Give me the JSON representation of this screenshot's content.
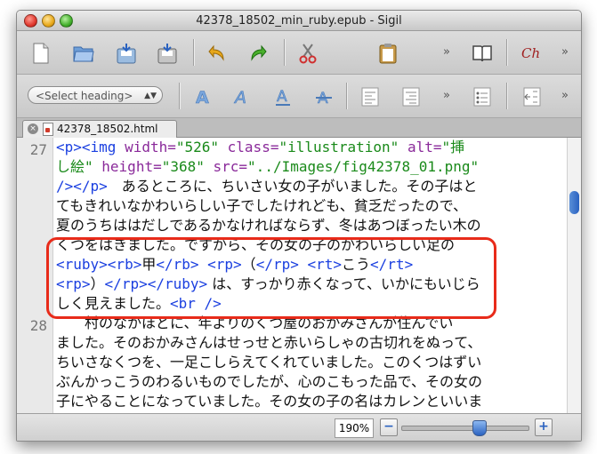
{
  "window": {
    "title": "42378_18502_min_ruby.epub - Sigil"
  },
  "toolbar1": {
    "icons": [
      "new-file-icon",
      "open-folder-icon",
      "save-icon",
      "save-as-icon",
      "undo-icon",
      "redo-icon",
      "cut-icon",
      "paste-icon",
      "book-view-icon",
      "spellcheck-icon"
    ],
    "overflow_label": "»"
  },
  "toolbar2": {
    "heading_select": "<Select heading>",
    "icons": [
      "bold-icon",
      "italic-icon",
      "underline-icon",
      "strikethrough-icon",
      "align-left-icon",
      "align-right-icon",
      "bullet-list-icon",
      "indent-icon"
    ],
    "overflow_label": "»"
  },
  "tab": {
    "close_label": "×",
    "filename": "42378_18502.html"
  },
  "editor": {
    "line_numbers": [
      "27",
      "28"
    ],
    "lines": [
      [
        {
          "c": "tag",
          "t": "    <p><img "
        },
        {
          "c": "attr",
          "t": "width="
        },
        {
          "c": "val",
          "t": "\"526\" "
        },
        {
          "c": "attr",
          "t": "class="
        },
        {
          "c": "val",
          "t": "\"illustration\" "
        },
        {
          "c": "attr",
          "t": "alt="
        },
        {
          "c": "val",
          "t": "\"挿"
        }
      ],
      [
        {
          "c": "val",
          "t": "し絵\" "
        },
        {
          "c": "attr",
          "t": "height="
        },
        {
          "c": "val",
          "t": "\"368\" "
        },
        {
          "c": "attr",
          "t": "src="
        },
        {
          "c": "val",
          "t": "\"../Images/fig42378_01.png\""
        }
      ],
      [
        {
          "c": "tag",
          "t": " /></p>"
        },
        {
          "c": "txt",
          "t": "　あるところに、ちいさい女の子がいました。その子はと"
        }
      ],
      [
        {
          "c": "txt",
          "t": "てもきれいなかわいらしい子でしたけれども、貧乏だったので、"
        }
      ],
      [
        {
          "c": "txt",
          "t": "夏のうちははだしであるかなければならず、冬はあつぼったい木の"
        }
      ],
      [
        {
          "c": "txt",
          "t": "くつをはきました。ですから、その女の子のかわいらしい足の"
        }
      ],
      [
        {
          "c": "tag",
          "t": "<ruby><rb>"
        },
        {
          "c": "txt",
          "t": "甲"
        },
        {
          "c": "tag",
          "t": "</rb> <rp>"
        },
        {
          "c": "txt",
          "t": "（"
        },
        {
          "c": "tag",
          "t": "</rp> <rt>"
        },
        {
          "c": "txt",
          "t": "こう"
        },
        {
          "c": "tag",
          "t": "</rt>"
        }
      ],
      [
        {
          "c": "tag",
          "t": "<rp>"
        },
        {
          "c": "txt",
          "t": "）"
        },
        {
          "c": "tag",
          "t": "</rp></ruby>"
        },
        {
          "c": "txt",
          "t": " は、すっかり赤くなって、いかにもいじら"
        }
      ],
      [
        {
          "c": "txt",
          "t": "しく見えました。"
        },
        {
          "c": "tag",
          "t": "<br />"
        }
      ],
      [
        {
          "c": "txt",
          "t": "　　村のなかほどに、年よりのくつ屋のおかみさんが住んでい"
        }
      ],
      [
        {
          "c": "txt",
          "t": "ました。そのおかみさんはせっせと赤いらしゃの古切れをぬって、"
        }
      ],
      [
        {
          "c": "txt",
          "t": "ちいさなくつを、一足こしらえてくれていました。このくつはずい"
        }
      ],
      [
        {
          "c": "txt",
          "t": "ぶんかっこうのわるいものでしたが、心のこもった品で、その女の"
        }
      ],
      [
        {
          "c": "txt",
          "t": "子にやることになっていました。その女の子の名はカレンといいま"
        }
      ]
    ]
  },
  "status": {
    "zoom": "190%",
    "zoom_out_label": "−",
    "zoom_in_label": "+",
    "zoom_slider_value": 0.62
  },
  "colors": {
    "tag": "#1a3fe0",
    "attr": "#8a2a9a",
    "value": "#1a8a1a",
    "highlight": "#e82b1a"
  }
}
